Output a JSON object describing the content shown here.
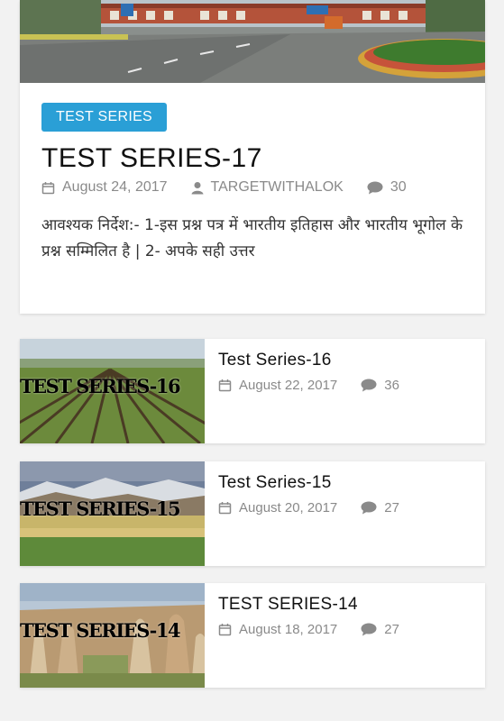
{
  "featured": {
    "category": "TEST SERIES",
    "title": "TEST SERIES-17",
    "date": "August 24, 2017",
    "author": "TARGETWITHALOK",
    "comments": "30",
    "excerpt": "आवश्यक निर्देश:- 1-इस प्रश्न पत्र में भारतीय इतिहास और भारतीय भूगोल के प्रश्न सम्मिलित है | 2- अपके सही उत्तर"
  },
  "posts": [
    {
      "thumb_text": "TEST SERIES-16",
      "title": "Test Series-16",
      "date": "August 22, 2017",
      "comments": "36"
    },
    {
      "thumb_text": "TEST SERIES-15",
      "title": "Test Series-15",
      "date": "August 20, 2017",
      "comments": "27"
    },
    {
      "thumb_text": "TEST SERIES-14",
      "title": "TEST SERIES-14",
      "date": "August 18, 2017",
      "comments": "27"
    }
  ],
  "icons": {
    "date": "calendar-icon",
    "author": "user-icon",
    "comments": "comment-bubble-icon"
  },
  "colors": {
    "badge": "#2a9fd6",
    "meta": "#8a8a8a"
  }
}
